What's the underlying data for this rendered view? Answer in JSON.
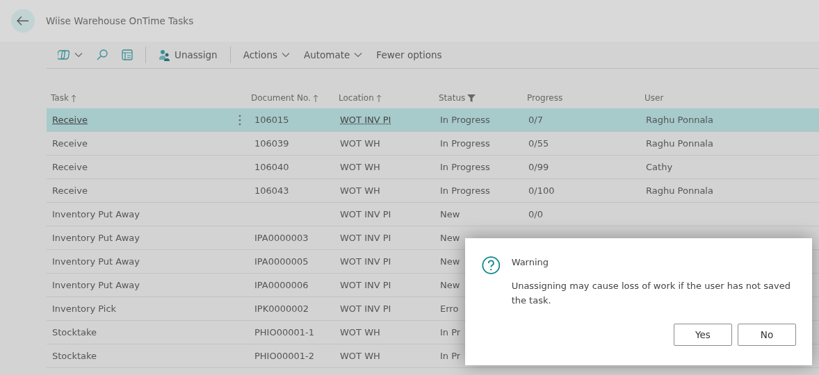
{
  "page": {
    "title": "Wiise Warehouse OnTime Tasks"
  },
  "toolbar": [
    {
      "kind": "icon-menu"
    },
    {
      "kind": "search"
    },
    {
      "kind": "layout"
    },
    {
      "kind": "separator"
    },
    {
      "kind": "button",
      "label": "Unassign"
    },
    {
      "kind": "separator"
    },
    {
      "kind": "menu",
      "label": "Actions"
    },
    {
      "kind": "menu",
      "label": "Automate"
    },
    {
      "kind": "link",
      "label": "Fewer options"
    }
  ],
  "table": {
    "columns": [
      {
        "label": "Task",
        "sorted": true,
        "filtered": false
      },
      {
        "label": "Document No.",
        "sorted": true,
        "filtered": false
      },
      {
        "label": "Location",
        "sorted": true,
        "filtered": false
      },
      {
        "label": "Status",
        "sorted": false,
        "filtered": true
      },
      {
        "label": "Progress",
        "sorted": false,
        "filtered": false
      },
      {
        "label": "User",
        "sorted": false,
        "filtered": false
      }
    ],
    "rows": [
      {
        "selected": true,
        "cells": [
          "Receive",
          "106015",
          "WOT INV PI",
          "In Progress",
          "0/7",
          "Raghu Ponnala"
        ]
      },
      {
        "selected": false,
        "cells": [
          "Receive",
          "106039",
          "WOT WH",
          "In Progress",
          "0/55",
          "Raghu Ponnala"
        ]
      },
      {
        "selected": false,
        "cells": [
          "Receive",
          "106040",
          "WOT WH",
          "In Progress",
          "0/99",
          "Cathy"
        ]
      },
      {
        "selected": false,
        "cells": [
          "Receive",
          "106043",
          "WOT WH",
          "In Progress",
          "0/100",
          "Raghu Ponnala"
        ]
      },
      {
        "selected": false,
        "cells": [
          "Inventory Put Away",
          "",
          "WOT INV PI",
          "New",
          "0/0",
          ""
        ]
      },
      {
        "selected": false,
        "cells": [
          "Inventory Put Away",
          "IPA0000003",
          "WOT INV PI",
          "New",
          "",
          ""
        ]
      },
      {
        "selected": false,
        "cells": [
          "Inventory Put Away",
          "IPA0000005",
          "WOT INV PI",
          "New",
          "",
          ""
        ]
      },
      {
        "selected": false,
        "cells": [
          "Inventory Put Away",
          "IPA0000006",
          "WOT INV PI",
          "New",
          "",
          ""
        ]
      },
      {
        "selected": false,
        "cells": [
          "Inventory Pick",
          "IPK0000002",
          "WOT INV PI",
          "Erro",
          "",
          ""
        ]
      },
      {
        "selected": false,
        "cells": [
          "Stocktake",
          "PHIO00001-1",
          "WOT WH",
          "In Pr",
          "",
          ""
        ]
      },
      {
        "selected": false,
        "cells": [
          "Stocktake",
          "PHIO00001-2",
          "WOT WH",
          "In Pr",
          "",
          ""
        ]
      }
    ]
  },
  "dialog": {
    "title": "Warning",
    "message": "Unassigning may cause loss of work if the user has not saved the task.",
    "buttons": [
      "Yes",
      "No"
    ]
  }
}
